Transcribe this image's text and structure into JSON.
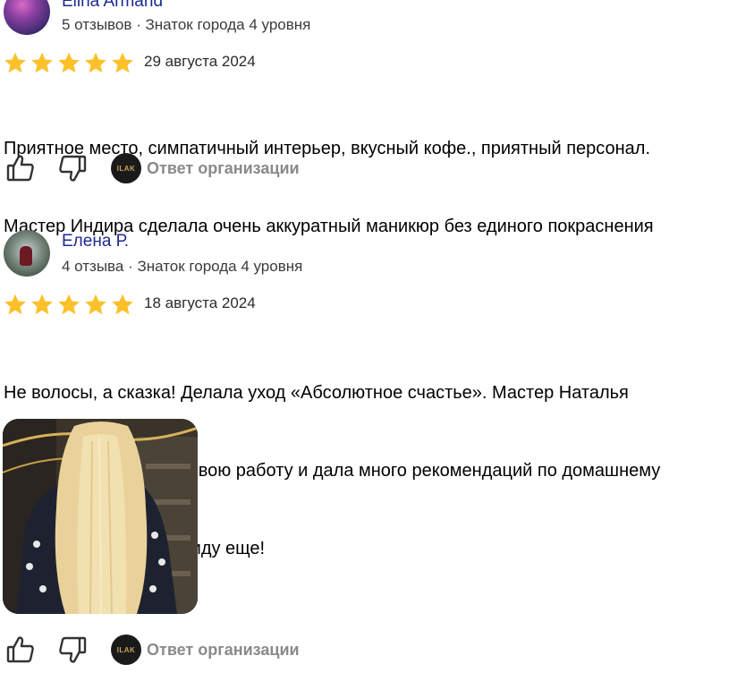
{
  "reviews": [
    {
      "author": "Elina Armand",
      "meta": "5 отзывов · Знаток города 4 уровня",
      "rating": 5,
      "date": "29 августа 2024",
      "text_lines": [
        "Приятное место, симпатичный интерьер, вкусный кофе., приятный персонал.",
        "Мастер Индира сделала очень аккуратный маникюр без единого покраснения"
      ],
      "org_reply_label": "Ответ организации",
      "org_logo_text": "ILAK"
    },
    {
      "author": "Елена Р.",
      "meta": "4 отзыва · Знаток города 4 уровня",
      "rating": 5,
      "date": "18 августа 2024",
      "text_lines": [
        "Не волосы, а сказка! Делала уход «Абсолютное счастье». Мастер Наталья",
        "превосходно сделала свою работу и дала много рекомендаций по домашнему",
        "уходу. Обязательно приду еще!"
      ],
      "org_reply_label": "Ответ организации",
      "org_logo_text": "ILAK"
    }
  ],
  "colors": {
    "star": "#fcc12a",
    "author": "#1d2a90",
    "muted": "#8a8a8a"
  },
  "icons": [
    "thumbs-up-icon",
    "thumbs-down-icon",
    "star-icon"
  ]
}
